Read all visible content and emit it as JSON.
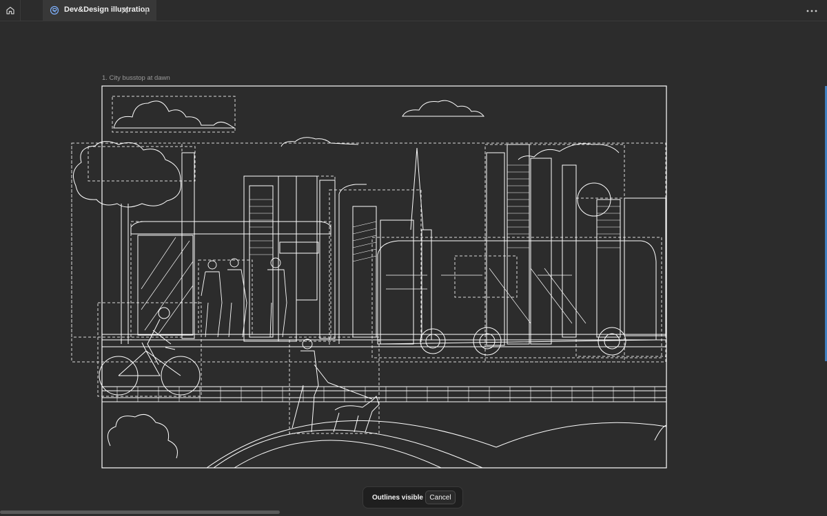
{
  "tabs": [
    {
      "label": "Dev&Design illustration",
      "icon": "figma-file-icon",
      "active": true
    }
  ],
  "icons": {
    "home": "home-icon",
    "close": "close-icon",
    "new_tab": "plus-icon",
    "more": "ellipsis-icon"
  },
  "canvas": {
    "frame_label": "1. City busstop at dawn",
    "background_color": "#2c2c2c",
    "outline_color": "#ffffff"
  },
  "toolbar": {
    "status": "Outlines visible",
    "cancel_label": "Cancel"
  },
  "colors": {
    "accent": "#3f7fbf",
    "tab_active": "#383838"
  }
}
